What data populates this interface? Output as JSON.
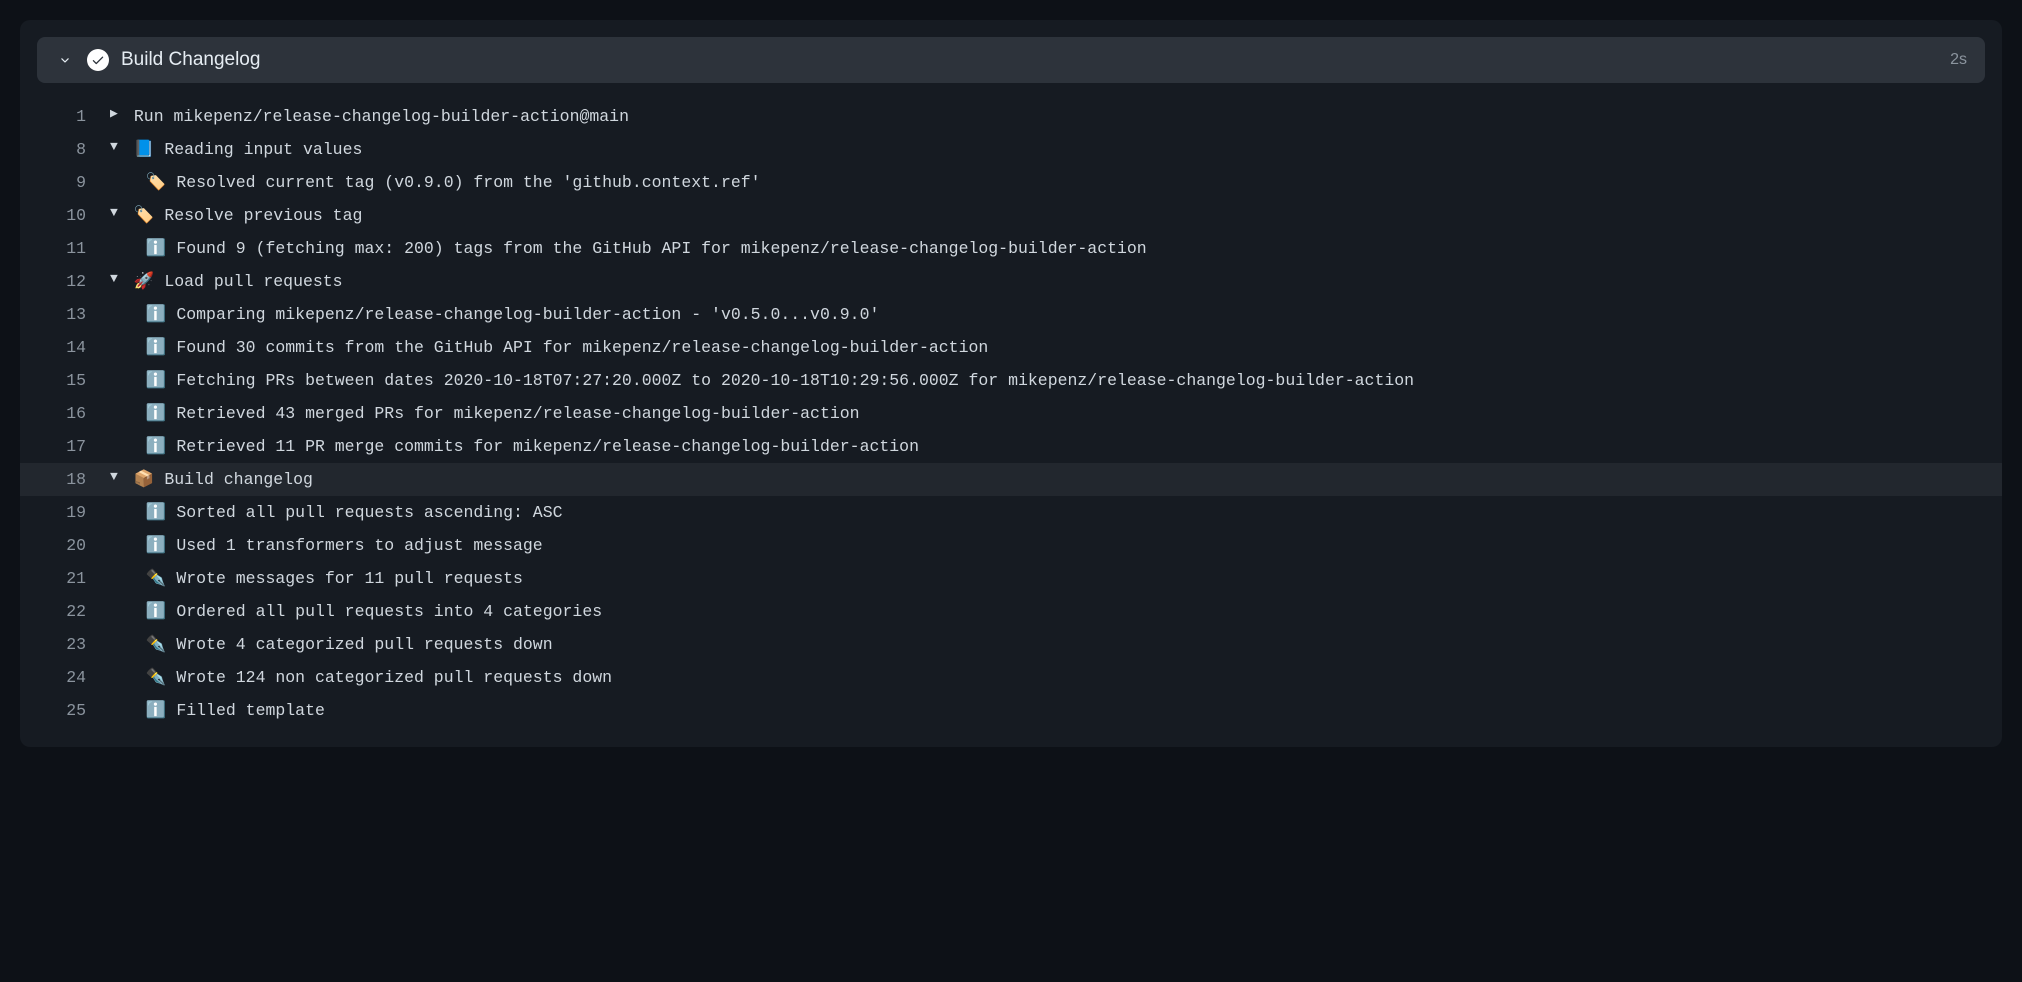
{
  "header": {
    "title": "Build Changelog",
    "duration": "2s"
  },
  "lines": [
    {
      "num": "1",
      "fold": "right",
      "highlighted": false,
      "indent": 0,
      "text": "Run mikepenz/release-changelog-builder-action@main"
    },
    {
      "num": "8",
      "fold": "down",
      "highlighted": false,
      "indent": 0,
      "text": "📘 Reading input values"
    },
    {
      "num": "9",
      "fold": "none",
      "highlighted": false,
      "indent": 1,
      "text": "🏷️ Resolved current tag (v0.9.0) from the 'github.context.ref'"
    },
    {
      "num": "10",
      "fold": "down",
      "highlighted": false,
      "indent": 0,
      "text": "🏷️ Resolve previous tag"
    },
    {
      "num": "11",
      "fold": "none",
      "highlighted": false,
      "indent": 1,
      "text": "ℹ️ Found 9 (fetching max: 200) tags from the GitHub API for mikepenz/release-changelog-builder-action"
    },
    {
      "num": "12",
      "fold": "down",
      "highlighted": false,
      "indent": 0,
      "text": "🚀 Load pull requests"
    },
    {
      "num": "13",
      "fold": "none",
      "highlighted": false,
      "indent": 1,
      "text": "ℹ️ Comparing mikepenz/release-changelog-builder-action - 'v0.5.0...v0.9.0'"
    },
    {
      "num": "14",
      "fold": "none",
      "highlighted": false,
      "indent": 1,
      "text": "ℹ️ Found 30 commits from the GitHub API for mikepenz/release-changelog-builder-action"
    },
    {
      "num": "15",
      "fold": "none",
      "highlighted": false,
      "indent": 1,
      "text": "ℹ️ Fetching PRs between dates 2020-10-18T07:27:20.000Z to 2020-10-18T10:29:56.000Z for mikepenz/release-changelog-builder-action"
    },
    {
      "num": "16",
      "fold": "none",
      "highlighted": false,
      "indent": 1,
      "text": "ℹ️ Retrieved 43 merged PRs for mikepenz/release-changelog-builder-action"
    },
    {
      "num": "17",
      "fold": "none",
      "highlighted": false,
      "indent": 1,
      "text": "ℹ️ Retrieved 11 PR merge commits for mikepenz/release-changelog-builder-action"
    },
    {
      "num": "18",
      "fold": "down",
      "highlighted": true,
      "indent": 0,
      "text": "📦 Build changelog"
    },
    {
      "num": "19",
      "fold": "none",
      "highlighted": false,
      "indent": 1,
      "text": "ℹ️ Sorted all pull requests ascending: ASC"
    },
    {
      "num": "20",
      "fold": "none",
      "highlighted": false,
      "indent": 1,
      "text": "ℹ️ Used 1 transformers to adjust message"
    },
    {
      "num": "21",
      "fold": "none",
      "highlighted": false,
      "indent": 1,
      "text": "✒️ Wrote messages for 11 pull requests"
    },
    {
      "num": "22",
      "fold": "none",
      "highlighted": false,
      "indent": 1,
      "text": "ℹ️ Ordered all pull requests into 4 categories"
    },
    {
      "num": "23",
      "fold": "none",
      "highlighted": false,
      "indent": 1,
      "text": "✒️ Wrote 4 categorized pull requests down"
    },
    {
      "num": "24",
      "fold": "none",
      "highlighted": false,
      "indent": 1,
      "text": "✒️ Wrote 124 non categorized pull requests down"
    },
    {
      "num": "25",
      "fold": "none",
      "highlighted": false,
      "indent": 1,
      "text": "ℹ️ Filled template"
    }
  ]
}
